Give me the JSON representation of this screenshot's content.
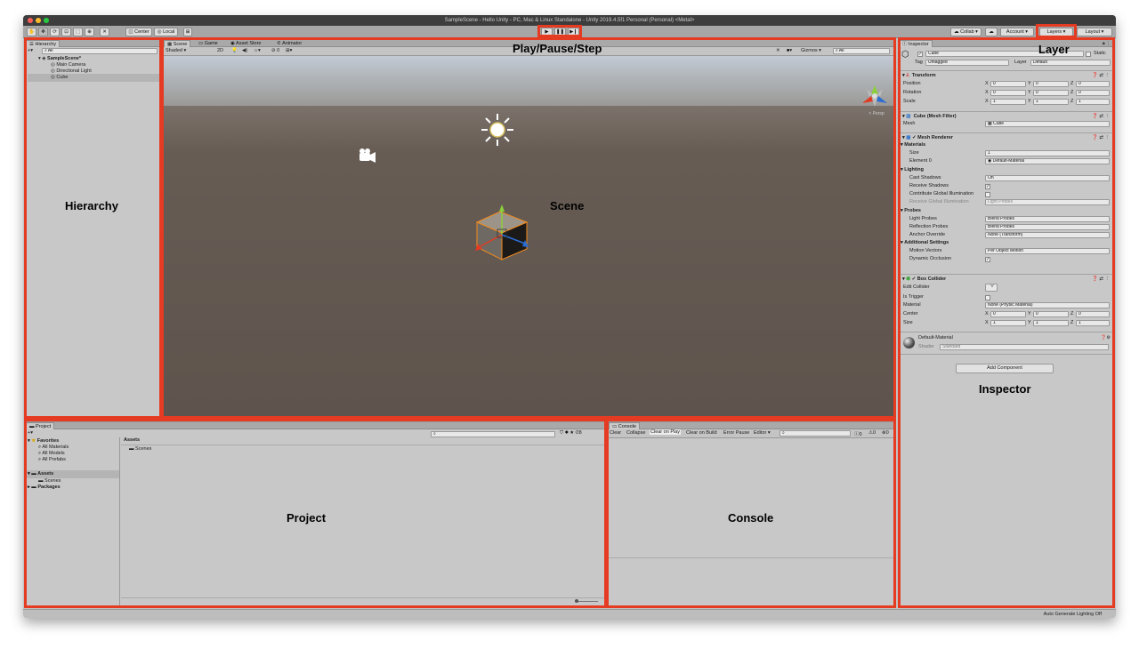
{
  "window": {
    "title": "SampleScene - Hello Unity - PC, Mac & Linux Standalone - Unity 2019.4.5f1 Personal (Personal) <Metal>"
  },
  "toolbar": {
    "center": "Center",
    "local": "Local",
    "collab": "Collab",
    "account": "Account",
    "layers": "Layers",
    "layout": "Layout",
    "play": "▶",
    "pause": "❚❚",
    "step": "▶❙"
  },
  "annotations": {
    "hierarchy": "Hierarchy",
    "scene": "Scene",
    "play": "Play/Pause/Step",
    "layer": "Layer",
    "inspector": "Inspector",
    "project": "Project",
    "console": "Console"
  },
  "hierarchy": {
    "tab": "Hierarchy",
    "search": "All",
    "scene": "SampleScene*",
    "items": [
      "Main Camera",
      "Directional Light",
      "Cube"
    ]
  },
  "scene_view": {
    "tabs": [
      "Scene",
      "Game",
      "Asset Store",
      "Animator"
    ],
    "shading": "Shaded",
    "mode2d": "2D",
    "gizmos": "Gizmos",
    "search": "All",
    "fx_count": "0",
    "persp": "< Persp"
  },
  "inspector": {
    "tab": "Inspector",
    "object": "Cube",
    "static": "Static",
    "tag_label": "Tag",
    "tag": "Untagged",
    "layer_label": "Layer",
    "layer": "Default",
    "transform": {
      "title": "Transform",
      "rows": [
        {
          "label": "Position",
          "x": "0",
          "y": "0",
          "z": "0"
        },
        {
          "label": "Rotation",
          "x": "0",
          "y": "0",
          "z": "0"
        },
        {
          "label": "Scale",
          "x": "1",
          "y": "1",
          "z": "1"
        }
      ]
    },
    "mesh_filter": {
      "title": "Cube (Mesh Filter)",
      "mesh_label": "Mesh",
      "mesh": "Cube"
    },
    "mesh_renderer": {
      "title": "Mesh Renderer",
      "materials": "Materials",
      "size_label": "Size",
      "size": "1",
      "element_label": "Element 0",
      "element": "Default-Material",
      "lighting": "Lighting",
      "cast_label": "Cast Shadows",
      "cast": "On",
      "receive_label": "Receive Shadows",
      "contrib_label": "Contribute Global Illumination",
      "recgi_label": "Receive Global Illumination",
      "recgi": "Light Probes",
      "probes": "Probes",
      "lp_label": "Light Probes",
      "lp": "Blend Probes",
      "rp_label": "Reflection Probes",
      "rp": "Blend Probes",
      "anchor_label": "Anchor Override",
      "anchor": "None (Transform)",
      "additional": "Additional Settings",
      "mv_label": "Motion Vectors",
      "mv": "Per Object Motion",
      "occ_label": "Dynamic Occlusion"
    },
    "box_collider": {
      "title": "Box Collider",
      "edit_label": "Edit Collider",
      "trigger_label": "Is Trigger",
      "material_label": "Material",
      "material": "None (Physic Material)",
      "center_label": "Center",
      "cx": "0",
      "cy": "0",
      "cz": "0",
      "size_label": "Size",
      "sx": "1",
      "sy": "1",
      "sz": "1"
    },
    "material": {
      "name": "Default-Material",
      "shader_label": "Shader",
      "shader": "Standard"
    },
    "add_component": "Add Component",
    "axes": {
      "x": "X",
      "y": "Y",
      "z": "Z"
    }
  },
  "project": {
    "tab": "Project",
    "favorites": "Favorites",
    "fav_items": [
      "All Materials",
      "All Models",
      "All Prefabs"
    ],
    "assets": "Assets",
    "asset_sub": "Scenes",
    "packages": "Packages",
    "breadcrumb": "Assets",
    "content": "Scenes"
  },
  "console": {
    "tab": "Console",
    "buttons": [
      "Clear",
      "Collapse",
      "Clear on Play",
      "Clear on Build",
      "Error Pause",
      "Editor"
    ],
    "c_info": "0",
    "c_warn": "0",
    "c_err": "0"
  },
  "status": {
    "text": "Auto Generate Lighting Off"
  },
  "colors": {
    "annotation": "#e53b23",
    "sky_top": "#c0c8d2",
    "ground": "#615750"
  }
}
